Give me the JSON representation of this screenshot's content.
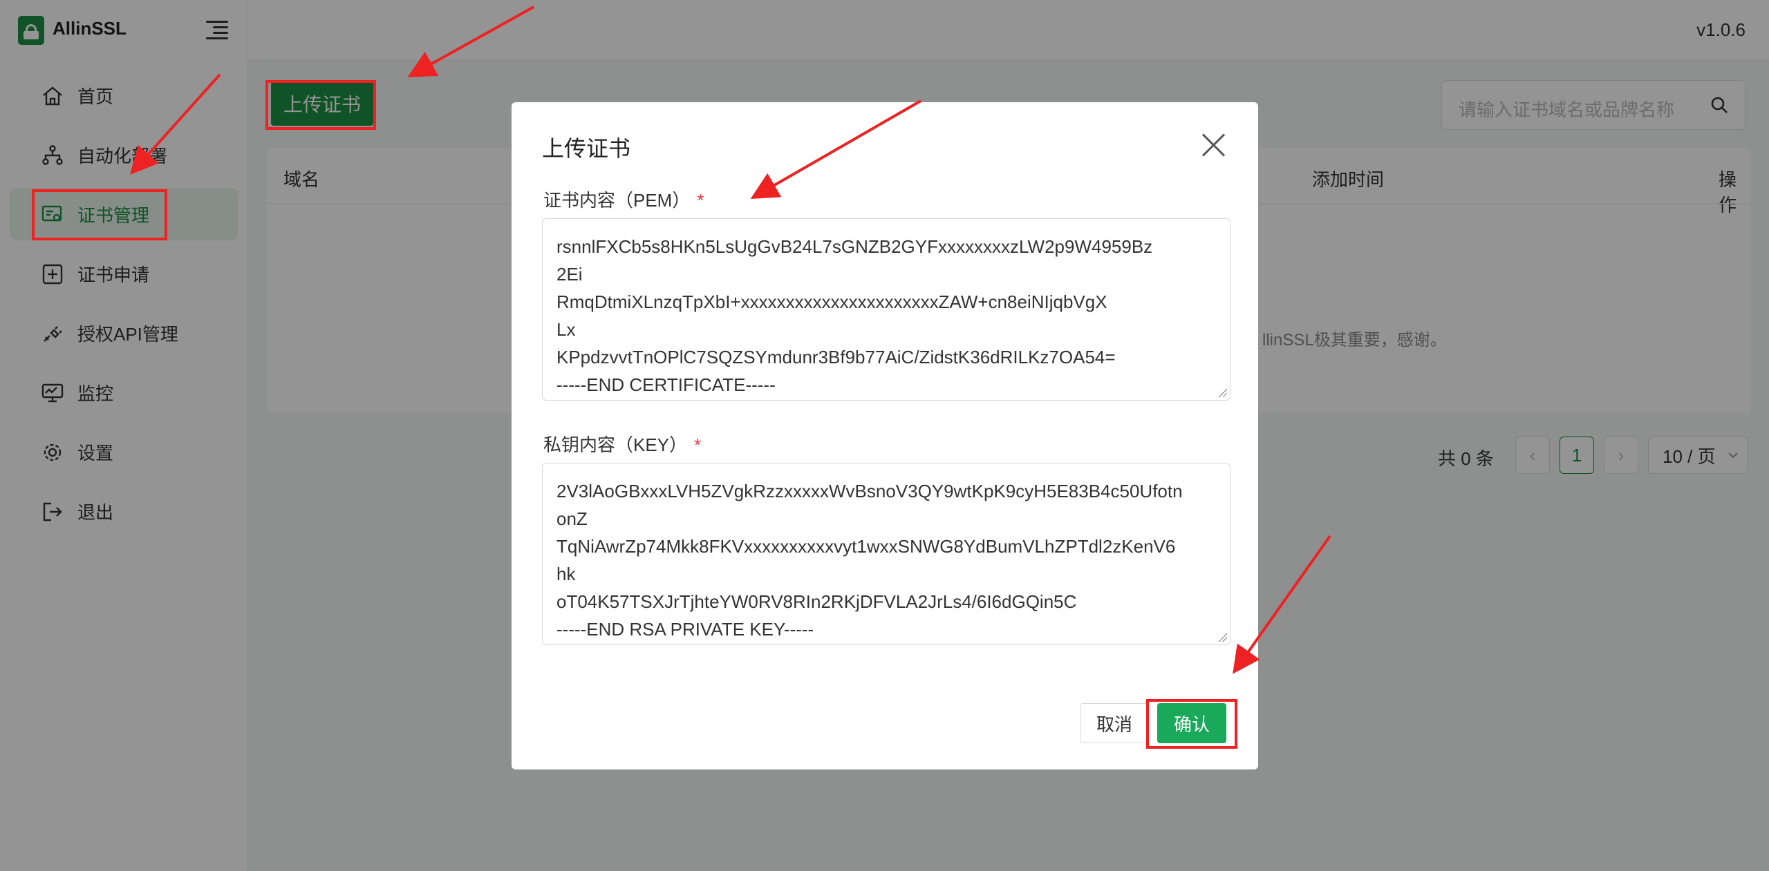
{
  "app": {
    "name": "AllinSSL",
    "version": "v1.0.6"
  },
  "sidebar": {
    "items": [
      {
        "label": "首页",
        "icon": "home-icon"
      },
      {
        "label": "自动化部署",
        "icon": "workflow-icon"
      },
      {
        "label": "证书管理",
        "icon": "certificate-icon",
        "active": true
      },
      {
        "label": "证书申请",
        "icon": "plus-square-icon"
      },
      {
        "label": "授权API管理",
        "icon": "api-key-icon"
      },
      {
        "label": "监控",
        "icon": "monitor-icon"
      },
      {
        "label": "设置",
        "icon": "gear-icon"
      },
      {
        "label": "退出",
        "icon": "logout-icon"
      }
    ]
  },
  "toolbar": {
    "upload_label": "上传证书",
    "search_placeholder": "请输入证书域名或品牌名称"
  },
  "table": {
    "columns": [
      "域名",
      "添加时间",
      "操作"
    ],
    "empty_text_partial": "llinSSL极其重要，感谢。"
  },
  "pagination": {
    "total": "共 0 条",
    "prev": "‹",
    "current_page": "1",
    "next": "›",
    "page_size": "10 / 页"
  },
  "modal": {
    "title": "上传证书",
    "cert_label": "证书内容（PEM）",
    "key_label": "私钥内容（KEY）",
    "required_mark": "*",
    "cert_lines": [
      "rsnnlFXCb5s8HKn5LsUgGvB24L7sGNZB2GYFxxxxxxxxzLW2p9W4959Bz",
      "2Ei",
      "RmqDtmiXLnzqTpXbI+xxxxxxxxxxxxxxxxxxxxxxZAW+cn8eiNIjqbVgX",
      "Lx",
      "KPpdzvvtTnOPlC7SQZSYmdunr3Bf9b77AiC/ZidstK36dRILKz7OA54=",
      "-----END CERTIFICATE-----"
    ],
    "key_lines": [
      "2V3lAoGBxxxLVH5ZVgkRzzxxxxxWvBsnoV3QY9wtKpK9cyH5E83B4c50Ufotn",
      "onZ",
      "TqNiAwrZp74Mkk8FKVxxxxxxxxxxvyt1wxxSNWG8YdBumVLhZPTdl2zKenV6",
      "hk",
      "oT04K57TSXJrTjhteYW0RV8RIn2RKjDFVLA2JrLs4/6I6dGQin5C",
      "-----END RSA PRIVATE KEY-----"
    ],
    "cancel_label": "取消",
    "confirm_label": "确认"
  },
  "colors": {
    "brand": "#1a8f44",
    "confirm": "#1aa85a",
    "annotation": "#ee2222",
    "overlay": "rgba(0,0,0,0.42)"
  }
}
